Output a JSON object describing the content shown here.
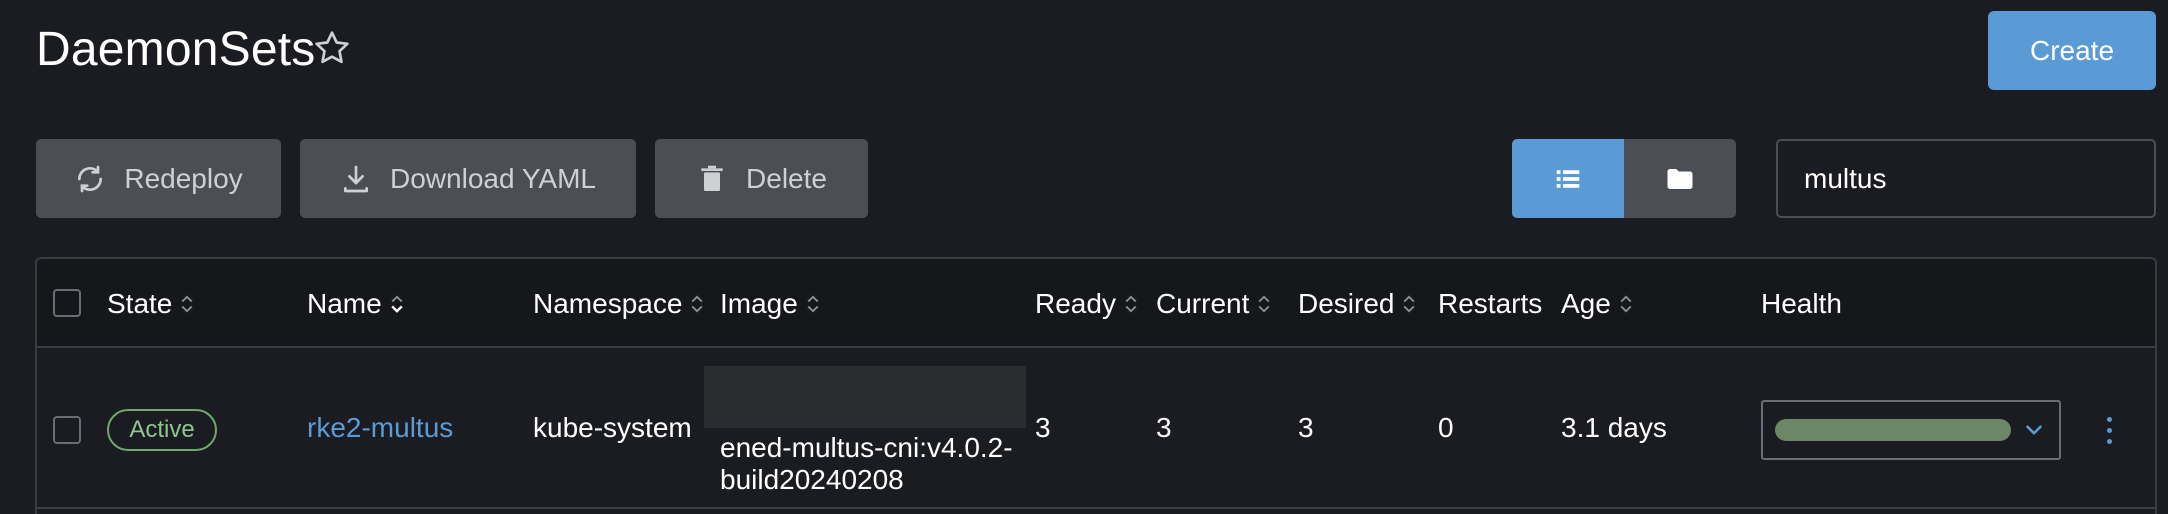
{
  "header": {
    "title": "DaemonSets",
    "create_label": "Create"
  },
  "toolbar": {
    "redeploy_label": "Redeploy",
    "download_label": "Download YAML",
    "delete_label": "Delete",
    "search_value": "multus"
  },
  "table": {
    "columns": [
      "State",
      "Name",
      "Namespace",
      "Image",
      "Ready",
      "Current",
      "Desired",
      "Restarts",
      "Age",
      "Health"
    ],
    "rows": [
      {
        "state": "Active",
        "name": "rke2-multus",
        "namespace": "kube-system",
        "image": "ened-multus-cni:v4.0.2-build20240208",
        "ready": "3",
        "current": "3",
        "desired": "3",
        "restarts": "0",
        "age": "3.1 days"
      }
    ]
  },
  "colors": {
    "accent": "#5b9bd5",
    "active_badge": "#6fa86f",
    "health_bar": "#6b8766"
  }
}
